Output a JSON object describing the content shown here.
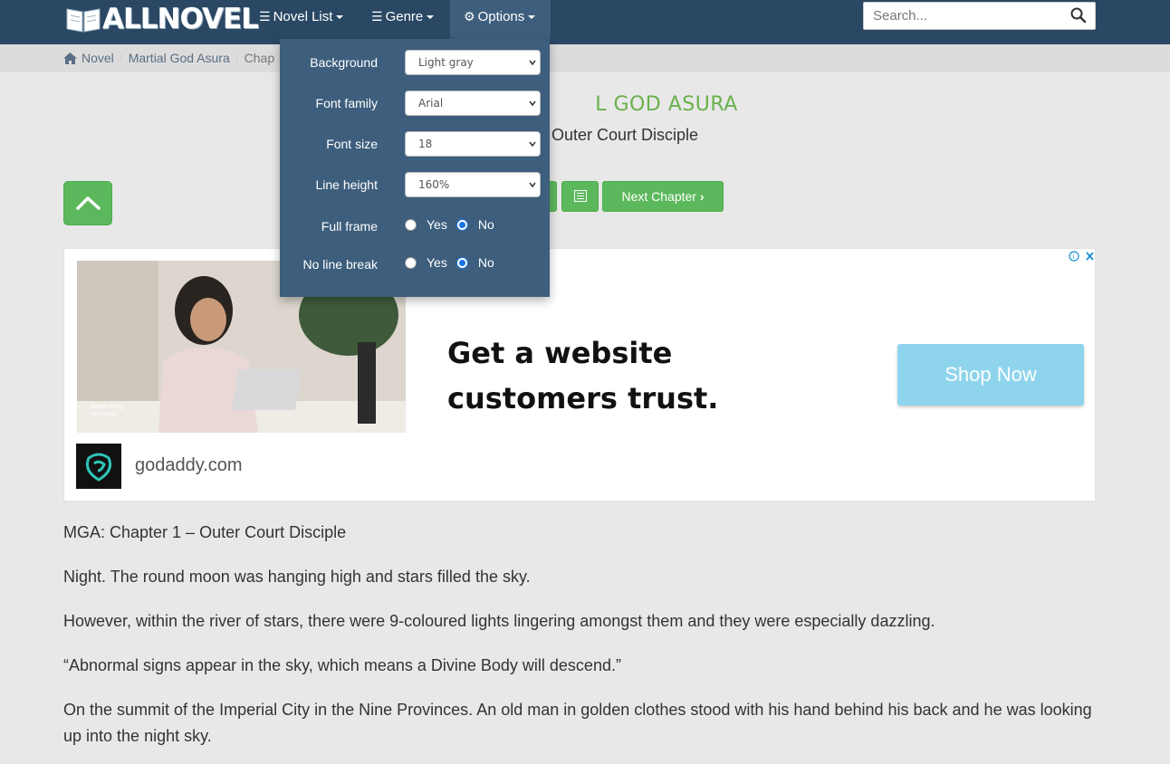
{
  "navbar": {
    "logo_text": "ALLNOVEL",
    "menu": [
      {
        "label": "Novel List",
        "icon": "list-icon"
      },
      {
        "label": "Genre",
        "icon": "list-icon"
      },
      {
        "label": "Options",
        "icon": "gear-icon"
      }
    ],
    "search": {
      "placeholder": "Search...",
      "value": ""
    }
  },
  "breadcrumb": {
    "home": "Novel",
    "novel": "Martial God Asura",
    "chapter_partial": "Chap"
  },
  "novel": {
    "title": "L GOD ASURA",
    "chapter_title": "Outer Court Disciple"
  },
  "nav_buttons": {
    "next": "Next Chapter"
  },
  "options": {
    "background": {
      "label": "Background",
      "value": "Light gray"
    },
    "font_family": {
      "label": "Font family",
      "value": "Arial"
    },
    "font_size": {
      "label": "Font size",
      "value": "18"
    },
    "line_height": {
      "label": "Line height",
      "value": "160%"
    },
    "full_frame": {
      "label": "Full frame",
      "yes": "Yes",
      "no": "No",
      "selected": "No"
    },
    "no_line_break": {
      "label": "No line break",
      "yes": "Yes",
      "no": "No",
      "selected": "No"
    }
  },
  "ad": {
    "headline": "Get a website customers trust.",
    "cta": "Shop Now",
    "domain": "godaddy.com",
    "photo_caption_line1": "Sarah Fung",
    "photo_caption_line2": "The Hula"
  },
  "content": {
    "paragraphs": [
      "MGA: Chapter 1 – Outer Court Disciple",
      "Night. The round moon was hanging high and stars filled the sky.",
      "However, within the river of stars, there were 9-coloured lights lingering amongst them and they were especially dazzling.",
      "“Abnormal signs appear in the sky, which means a Divine Body will descend.”",
      "On the summit of the Imperial City in the Nine Provinces. An old man in golden clothes stood with his hand behind his back and he was looking up into the night sky."
    ]
  },
  "colors": {
    "navbar": "#2a4864",
    "options_panel": "#3d5e7c",
    "button_green": "#5cb85c",
    "title_green": "#6ab04c",
    "ad_cta": "#8ed4ec"
  }
}
